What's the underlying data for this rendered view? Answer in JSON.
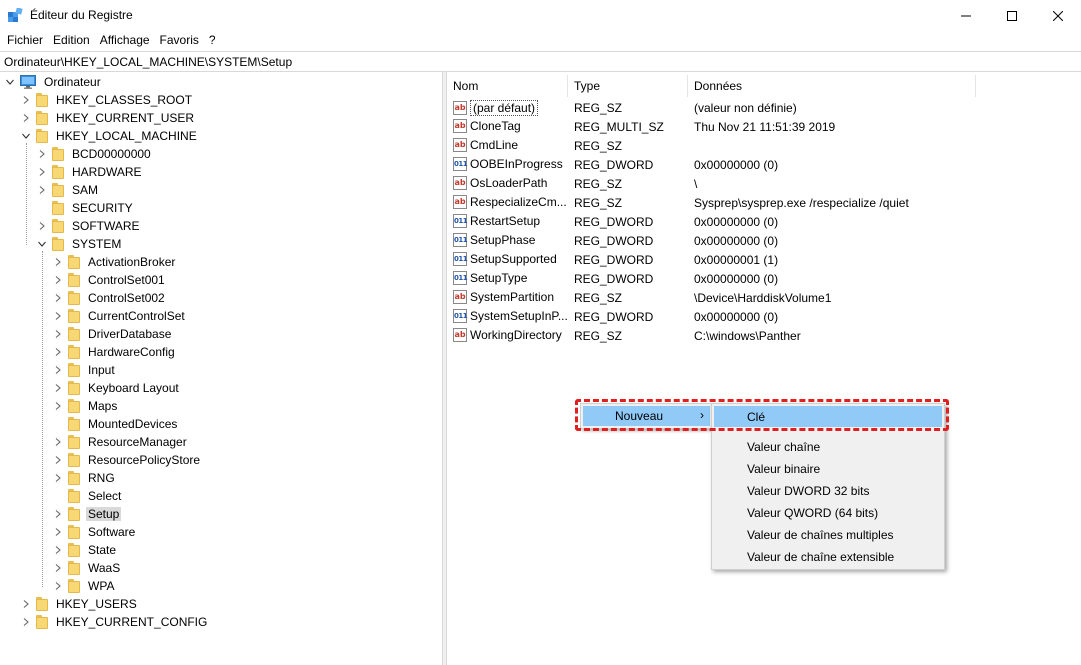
{
  "window": {
    "title": "Éditeur du Registre"
  },
  "menu": [
    "Fichier",
    "Edition",
    "Affichage",
    "Favoris",
    "?"
  ],
  "address": "Ordinateur\\HKEY_LOCAL_MACHINE\\SYSTEM\\Setup",
  "tree": [
    {
      "label": "Ordinateur",
      "level": 0,
      "expanded": true,
      "computer": true
    },
    {
      "label": "HKEY_CLASSES_ROOT",
      "level": 1
    },
    {
      "label": "HKEY_CURRENT_USER",
      "level": 1
    },
    {
      "label": "HKEY_LOCAL_MACHINE",
      "level": 1,
      "expanded": true
    },
    {
      "label": "BCD00000000",
      "level": 2
    },
    {
      "label": "HARDWARE",
      "level": 2
    },
    {
      "label": "SAM",
      "level": 2
    },
    {
      "label": "SECURITY",
      "level": 2,
      "nochev": true
    },
    {
      "label": "SOFTWARE",
      "level": 2
    },
    {
      "label": "SYSTEM",
      "level": 2,
      "expanded": true
    },
    {
      "label": "ActivationBroker",
      "level": 3
    },
    {
      "label": "ControlSet001",
      "level": 3
    },
    {
      "label": "ControlSet002",
      "level": 3
    },
    {
      "label": "CurrentControlSet",
      "level": 3
    },
    {
      "label": "DriverDatabase",
      "level": 3
    },
    {
      "label": "HardwareConfig",
      "level": 3
    },
    {
      "label": "Input",
      "level": 3
    },
    {
      "label": "Keyboard Layout",
      "level": 3
    },
    {
      "label": "Maps",
      "level": 3
    },
    {
      "label": "MountedDevices",
      "level": 3,
      "nochev": true
    },
    {
      "label": "ResourceManager",
      "level": 3
    },
    {
      "label": "ResourcePolicyStore",
      "level": 3
    },
    {
      "label": "RNG",
      "level": 3
    },
    {
      "label": "Select",
      "level": 3,
      "nochev": true
    },
    {
      "label": "Setup",
      "level": 3,
      "selected": true
    },
    {
      "label": "Software",
      "level": 3
    },
    {
      "label": "State",
      "level": 3
    },
    {
      "label": "WaaS",
      "level": 3
    },
    {
      "label": "WPA",
      "level": 3
    },
    {
      "label": "HKEY_USERS",
      "level": 1
    },
    {
      "label": "HKEY_CURRENT_CONFIG",
      "level": 1
    }
  ],
  "columns": {
    "name": "Nom",
    "type": "Type",
    "data": "Données"
  },
  "values": [
    {
      "name": "(par défaut)",
      "type": "REG_SZ",
      "data": "(valeur non définie)",
      "kind": "sz",
      "focused": true
    },
    {
      "name": "CloneTag",
      "type": "REG_MULTI_SZ",
      "data": "Thu Nov 21 11:51:39 2019",
      "kind": "sz"
    },
    {
      "name": "CmdLine",
      "type": "REG_SZ",
      "data": "",
      "kind": "sz"
    },
    {
      "name": "OOBEInProgress",
      "type": "REG_DWORD",
      "data": "0x00000000 (0)",
      "kind": "bin"
    },
    {
      "name": "OsLoaderPath",
      "type": "REG_SZ",
      "data": "\\",
      "kind": "sz"
    },
    {
      "name": "RespecializeCm...",
      "type": "REG_SZ",
      "data": "Sysprep\\sysprep.exe /respecialize /quiet",
      "kind": "sz"
    },
    {
      "name": "RestartSetup",
      "type": "REG_DWORD",
      "data": "0x00000000 (0)",
      "kind": "bin"
    },
    {
      "name": "SetupPhase",
      "type": "REG_DWORD",
      "data": "0x00000000 (0)",
      "kind": "bin"
    },
    {
      "name": "SetupSupported",
      "type": "REG_DWORD",
      "data": "0x00000001 (1)",
      "kind": "bin"
    },
    {
      "name": "SetupType",
      "type": "REG_DWORD",
      "data": "0x00000000 (0)",
      "kind": "bin"
    },
    {
      "name": "SystemPartition",
      "type": "REG_SZ",
      "data": "\\Device\\HarddiskVolume1",
      "kind": "sz"
    },
    {
      "name": "SystemSetupInP...",
      "type": "REG_DWORD",
      "data": "0x00000000 (0)",
      "kind": "bin"
    },
    {
      "name": "WorkingDirectory",
      "type": "REG_SZ",
      "data": "C:\\windows\\Panther",
      "kind": "sz"
    }
  ],
  "icon_glyphs": {
    "sz": "ab",
    "bin": "011"
  },
  "context_menu": {
    "item": "Nouveau",
    "submenu": [
      "Clé",
      "Valeur chaîne",
      "Valeur binaire",
      "Valeur DWORD 32 bits",
      "Valeur QWORD (64 bits)",
      "Valeur de chaînes multiples",
      "Valeur de chaîne extensible"
    ],
    "highlighted": 0
  },
  "colors": {
    "highlight": "#91c9f7",
    "menu_bg": "#f0f0f0",
    "selection": "#d9d9d9",
    "annotation": "#e02020"
  }
}
